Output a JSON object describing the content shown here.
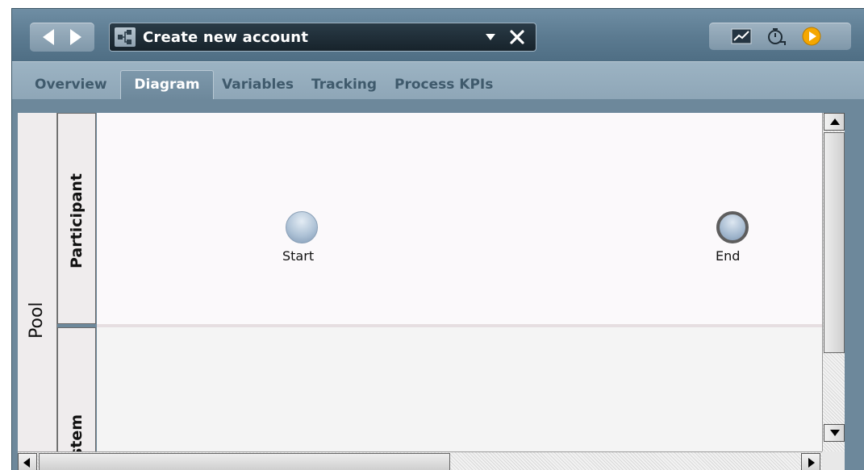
{
  "toolbar": {
    "back_icon": "arrow-left-icon",
    "forward_icon": "arrow-right-icon",
    "process_icon": "process-diagram-icon",
    "process_name": "Create new account",
    "dropdown_icon": "chevron-down-icon",
    "close_icon": "close-icon",
    "tools": [
      "chart-icon",
      "timer-icon",
      "play-icon"
    ],
    "play_color": "#f5a700"
  },
  "tabs": [
    {
      "label": "Overview",
      "active": false
    },
    {
      "label": "Diagram",
      "active": true
    },
    {
      "label": "Variables",
      "active": false
    },
    {
      "label": "Tracking",
      "active": false
    },
    {
      "label": "Process KPIs",
      "active": false
    }
  ],
  "diagram": {
    "pool_label": "Pool",
    "lanes": [
      {
        "label": "Participant"
      },
      {
        "label": "stem"
      }
    ],
    "events": [
      {
        "type": "start",
        "label": "Start"
      },
      {
        "type": "end",
        "label": "End"
      }
    ]
  },
  "colors": {
    "chrome": "#5f7f95",
    "tab_active": "#7d98ab",
    "lane_bg": "#fbf9fb",
    "event_fill": "#aec2d6"
  }
}
